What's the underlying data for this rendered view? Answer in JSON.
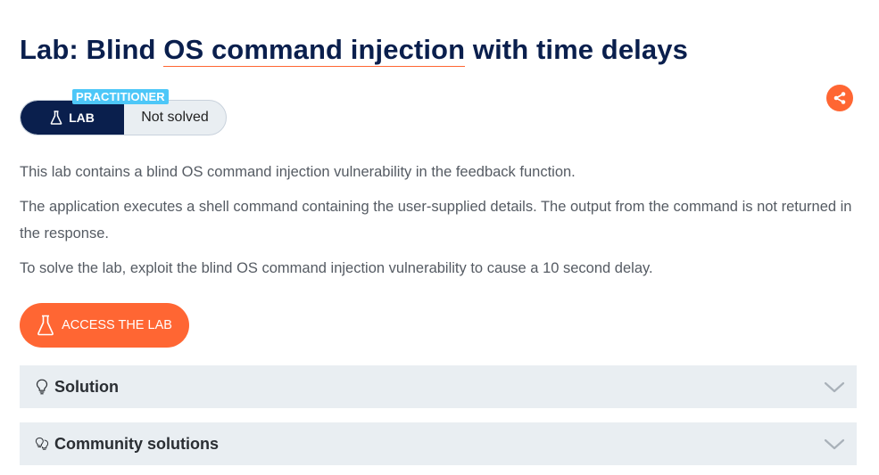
{
  "header": {
    "title_prefix": "Lab: Blind ",
    "title_link": "OS command injection",
    "title_suffix": " with time delays",
    "share_icon": "share-icon"
  },
  "badge": {
    "level": "PRACTITIONER",
    "type_label": "LAB",
    "type_icon": "flask-icon",
    "status": "Not solved"
  },
  "description": {
    "paragraphs": [
      "This lab contains a blind OS command injection vulnerability in the feedback function.",
      "The application executes a shell command containing the user-supplied details. The output from the command is not returned in the response.",
      "To solve the lab, exploit the blind OS command injection vulnerability to cause a 10 second delay."
    ]
  },
  "access_button": {
    "label": "ACCESS THE LAB",
    "icon": "flask-icon"
  },
  "accordions": [
    {
      "label": "Solution",
      "icon": "lightbulb-icon"
    },
    {
      "label": "Community solutions",
      "icon": "lightbulbs-icon"
    }
  ],
  "colors": {
    "navy": "#0a1f4d",
    "accent": "#ff6633",
    "level_tag": "#4dc7f8",
    "panel": "#e9eef2",
    "body_text": "#555b63"
  }
}
